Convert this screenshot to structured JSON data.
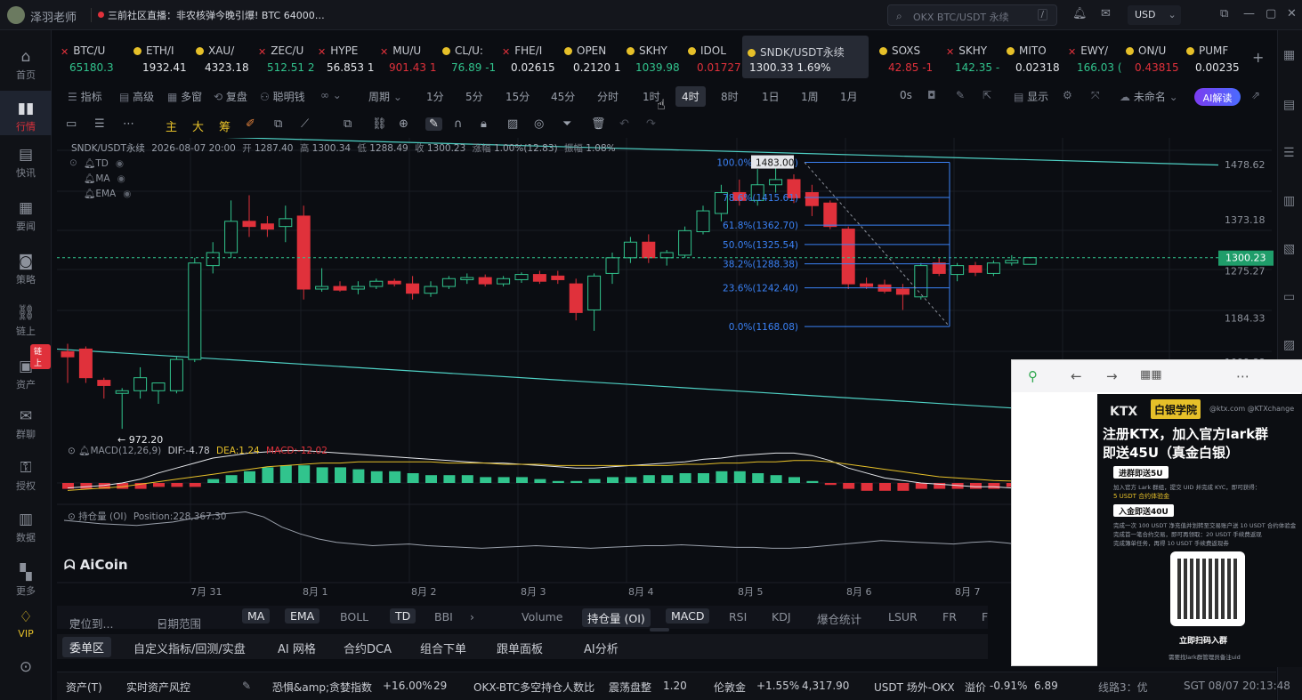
{
  "titlebar": {
    "user_name": "泽羽老师",
    "news": "三前社区直播：非农核弹今晚引爆! BTC 64000…",
    "search_placeholder": "OKX BTC/USDT 永续",
    "search_shortcut": "/",
    "currency": "USD"
  },
  "leftnav": {
    "items": [
      {
        "label": "首页",
        "icon": "home-icon"
      },
      {
        "label": "行情",
        "icon": "chart-icon"
      },
      {
        "label": "快讯",
        "icon": "news-icon"
      },
      {
        "label": "要闻",
        "icon": "document-icon"
      },
      {
        "label": "策略",
        "icon": "robot-icon"
      },
      {
        "label": "链上",
        "icon": "chain-icon"
      },
      {
        "label": "资产",
        "icon": "wallet-icon"
      },
      {
        "label": "群聊",
        "icon": "chat-icon"
      },
      {
        "label": "授权",
        "icon": "key-icon"
      },
      {
        "label": "数据",
        "icon": "data-icon"
      },
      {
        "label": "更多",
        "icon": "grid-icon"
      },
      {
        "label": "VIP",
        "icon": "vip-icon"
      }
    ],
    "badge": "链上"
  },
  "tickers": [
    {
      "symbol": "BTC/U",
      "price": "65180.3",
      "change": "",
      "dir": "up",
      "mark": "x"
    },
    {
      "symbol": "ETH/I",
      "price": "1932.41",
      "change": "",
      "dir": "wh",
      "mark": "yellow"
    },
    {
      "symbol": "XAU/",
      "price": "4323.18",
      "change": "",
      "dir": "wh",
      "mark": "yellow"
    },
    {
      "symbol": "ZEC/U",
      "price": "512.51",
      "change": "2",
      "dir": "up",
      "mark": "x"
    },
    {
      "symbol": "HYPE",
      "price": "56.853",
      "change": "1",
      "dir": "wh",
      "mark": "x"
    },
    {
      "symbol": "MU/U",
      "price": "901.43",
      "change": "1",
      "dir": "dn",
      "mark": "x"
    },
    {
      "symbol": "CL/U:",
      "price": "76.89",
      "change": "-1",
      "dir": "up",
      "mark": "yellow"
    },
    {
      "symbol": "FHE/I",
      "price": "0.02615",
      "change": "",
      "dir": "wh",
      "mark": "x"
    },
    {
      "symbol": "OPEN",
      "price": "0.2120",
      "change": "1",
      "dir": "wh",
      "mark": "yellow"
    },
    {
      "symbol": "SKHY",
      "price": "1039.98",
      "change": "",
      "dir": "up",
      "mark": "yellow"
    },
    {
      "symbol": "IDOL",
      "price": "0.01727",
      "change": "",
      "dir": "dn",
      "mark": "yellow"
    },
    {
      "symbol": "SNDK/USDT永续",
      "price": "1300.33",
      "change": "1.69%",
      "dir": "wh",
      "mark": "yellow",
      "active": true
    },
    {
      "symbol": "SOXS",
      "price": "42.85",
      "change": "-1",
      "dir": "dn",
      "mark": "yellow"
    },
    {
      "symbol": "SKHY",
      "price": "142.35",
      "change": "-",
      "dir": "up",
      "mark": "x"
    },
    {
      "symbol": "MITO",
      "price": "0.02318",
      "change": "",
      "dir": "wh",
      "mark": "yellow"
    },
    {
      "symbol": "EWY/",
      "price": "166.03",
      "change": "(",
      "dir": "up",
      "mark": "x"
    },
    {
      "symbol": "ON/U",
      "price": "0.43815",
      "change": "",
      "dir": "dn",
      "mark": "yellow"
    },
    {
      "symbol": "PUMF",
      "price": "0.00235",
      "change": "",
      "dir": "wh",
      "mark": "yellow"
    }
  ],
  "toolbar1": {
    "items": [
      "指标",
      "高级",
      "多窗",
      "复盘",
      "聪明钱",
      "周期",
      "1分",
      "5分",
      "15分",
      "45分",
      "分时",
      "1时",
      "4时",
      "8时",
      "1日",
      "1周",
      "1月",
      "0s",
      "显示",
      "未命名"
    ],
    "selected": "4时",
    "ai_button": "AI解读"
  },
  "toolbar2": {
    "items": [
      "主",
      "大",
      "筹"
    ]
  },
  "chart_header": {
    "pair": "SNDK/USDT永续",
    "datetime": "2026-08-07 20:00",
    "open_label": "开",
    "open": "1287.40",
    "high_label": "高",
    "high": "1300.34",
    "low_label": "低",
    "low": "1288.49",
    "close_label": "收",
    "close": "1300.23",
    "chg_label": "涨幅",
    "chg": "1.00%(12.83)",
    "amp_label": "振幅",
    "amp": "1.08%",
    "indicators": [
      "TD",
      "MA",
      "EMA"
    ]
  },
  "chart_data": {
    "type": "candlestick",
    "price_axis": [
      "1478.62",
      "1373.18",
      "1275.27",
      "1184.33",
      "1099.88"
    ],
    "current_price": "1300.23",
    "low_marker": "← 972.20",
    "x_labels": [
      "7月 31",
      "8月 1",
      "8月 2",
      "8月 3",
      "8月 4",
      "8月 5",
      "8月 6",
      "8月 7"
    ],
    "ylim": [
      950,
      1530
    ],
    "candles": [
      {
        "o": 1120,
        "h": 1135,
        "l": 1060,
        "c": 1110
      },
      {
        "o": 1125,
        "h": 1130,
        "l": 1060,
        "c": 1070
      },
      {
        "o": 1065,
        "h": 1070,
        "l": 1030,
        "c": 1055
      },
      {
        "o": 1040,
        "h": 1050,
        "l": 972,
        "c": 1045
      },
      {
        "o": 1045,
        "h": 1090,
        "l": 1030,
        "c": 1070
      },
      {
        "o": 1045,
        "h": 1060,
        "l": 1020,
        "c": 1060
      },
      {
        "o": 1045,
        "h": 1110,
        "l": 1040,
        "c": 1105
      },
      {
        "o": 1105,
        "h": 1300,
        "l": 1100,
        "c": 1290
      },
      {
        "o": 1285,
        "h": 1330,
        "l": 1270,
        "c": 1310
      },
      {
        "o": 1310,
        "h": 1410,
        "l": 1300,
        "c": 1370
      },
      {
        "o": 1370,
        "h": 1420,
        "l": 1340,
        "c": 1360
      },
      {
        "o": 1365,
        "h": 1380,
        "l": 1340,
        "c": 1355
      },
      {
        "o": 1360,
        "h": 1400,
        "l": 1330,
        "c": 1375
      },
      {
        "o": 1380,
        "h": 1400,
        "l": 1220,
        "c": 1240
      },
      {
        "o": 1240,
        "h": 1280,
        "l": 1235,
        "c": 1245
      },
      {
        "o": 1245,
        "h": 1255,
        "l": 1235,
        "c": 1238
      },
      {
        "o": 1240,
        "h": 1255,
        "l": 1230,
        "c": 1245
      },
      {
        "o": 1245,
        "h": 1260,
        "l": 1240,
        "c": 1255
      },
      {
        "o": 1255,
        "h": 1260,
        "l": 1245,
        "c": 1250
      },
      {
        "o": 1250,
        "h": 1265,
        "l": 1220,
        "c": 1232
      },
      {
        "o": 1232,
        "h": 1255,
        "l": 1225,
        "c": 1245
      },
      {
        "o": 1245,
        "h": 1265,
        "l": 1240,
        "c": 1260
      },
      {
        "o": 1258,
        "h": 1270,
        "l": 1250,
        "c": 1262
      },
      {
        "o": 1262,
        "h": 1268,
        "l": 1245,
        "c": 1250
      },
      {
        "o": 1250,
        "h": 1265,
        "l": 1245,
        "c": 1260
      },
      {
        "o": 1258,
        "h": 1272,
        "l": 1252,
        "c": 1268
      },
      {
        "o": 1268,
        "h": 1275,
        "l": 1250,
        "c": 1255
      },
      {
        "o": 1265,
        "h": 1275,
        "l": 1250,
        "c": 1258
      },
      {
        "o": 1250,
        "h": 1260,
        "l": 1180,
        "c": 1195
      },
      {
        "o": 1200,
        "h": 1270,
        "l": 1160,
        "c": 1265
      },
      {
        "o": 1270,
        "h": 1310,
        "l": 1250,
        "c": 1300
      },
      {
        "o": 1300,
        "h": 1340,
        "l": 1290,
        "c": 1330
      },
      {
        "o": 1330,
        "h": 1345,
        "l": 1290,
        "c": 1300
      },
      {
        "o": 1300,
        "h": 1315,
        "l": 1285,
        "c": 1310
      },
      {
        "o": 1305,
        "h": 1360,
        "l": 1300,
        "c": 1352
      },
      {
        "o": 1350,
        "h": 1400,
        "l": 1345,
        "c": 1390
      },
      {
        "o": 1385,
        "h": 1440,
        "l": 1370,
        "c": 1425
      },
      {
        "o": 1425,
        "h": 1450,
        "l": 1400,
        "c": 1410
      },
      {
        "o": 1410,
        "h": 1470,
        "l": 1400,
        "c": 1440
      },
      {
        "o": 1440,
        "h": 1483,
        "l": 1425,
        "c": 1450
      },
      {
        "o": 1450,
        "h": 1460,
        "l": 1405,
        "c": 1415
      },
      {
        "o": 1425,
        "h": 1440,
        "l": 1380,
        "c": 1400
      },
      {
        "o": 1405,
        "h": 1410,
        "l": 1355,
        "c": 1360
      },
      {
        "o": 1355,
        "h": 1360,
        "l": 1240,
        "c": 1250
      },
      {
        "o": 1250,
        "h": 1262,
        "l": 1240,
        "c": 1245
      },
      {
        "o": 1248,
        "h": 1258,
        "l": 1232,
        "c": 1236
      },
      {
        "o": 1240,
        "h": 1250,
        "l": 1200,
        "c": 1230
      },
      {
        "o": 1225,
        "h": 1290,
        "l": 1220,
        "c": 1285
      },
      {
        "o": 1290,
        "h": 1300,
        "l": 1265,
        "c": 1270
      },
      {
        "o": 1268,
        "h": 1290,
        "l": 1255,
        "c": 1285
      },
      {
        "o": 1285,
        "h": 1292,
        "l": 1265,
        "c": 1272
      },
      {
        "o": 1270,
        "h": 1295,
        "l": 1265,
        "c": 1290
      },
      {
        "o": 1290,
        "h": 1305,
        "l": 1285,
        "c": 1295
      },
      {
        "o": 1287.4,
        "h": 1300.34,
        "l": 1288.49,
        "c": 1300.23
      }
    ],
    "fib": [
      {
        "label": "100.0%(1483.00)",
        "price": 1483.0
      },
      {
        "label": "78.6%(1415.61)",
        "price": 1415.61
      },
      {
        "label": "61.8%(1362.70)",
        "price": 1362.7
      },
      {
        "label": "50.0%(1325.54)",
        "price": 1325.54
      },
      {
        "label": "38.2%(1288.38)",
        "price": 1288.38
      },
      {
        "label": "23.6%(1242.40)",
        "price": 1242.4
      },
      {
        "label": "0.0%(1168.08)",
        "price": 1168.08
      }
    ],
    "fib_high_label": "1483.00",
    "channel": {
      "upper": [
        1540,
        1478
      ],
      "lower": [
        1125,
        1080
      ]
    }
  },
  "macd": {
    "label": "MACD(12,26,9)",
    "dif": "DIF:-4.78",
    "dea": "DEA:1.24",
    "macd": "MACD:-12.02",
    "bars": [
      -3,
      -3,
      -3,
      -3,
      -3,
      -2,
      -2,
      -2,
      2,
      4,
      6,
      8,
      9,
      9,
      8,
      8,
      7,
      6,
      6,
      5,
      4,
      4,
      4,
      3,
      3,
      3,
      2,
      1,
      1,
      2,
      3,
      3,
      4,
      4,
      5,
      5,
      6,
      6,
      5,
      4,
      3,
      1,
      -1,
      -3,
      -4,
      -4,
      -4,
      -3,
      -3,
      -3,
      -3,
      -3,
      -2,
      -2
    ],
    "dif_line": [
      -4,
      -3,
      -2,
      0,
      3,
      8,
      12,
      16,
      20,
      22,
      24,
      25,
      26,
      26,
      25,
      24,
      23,
      22,
      21,
      20,
      19,
      18,
      17,
      16,
      16,
      15,
      14,
      13,
      12,
      12,
      13,
      14,
      15,
      16,
      17,
      19,
      20,
      22,
      23,
      24,
      24,
      22,
      18,
      12,
      8,
      4,
      2,
      0,
      -1,
      -2,
      -3,
      -3,
      -4,
      -4.78
    ],
    "dea_line": [
      -6,
      -5,
      -4,
      -3,
      -1,
      1,
      3,
      5,
      7,
      9,
      11,
      13,
      14,
      15,
      16,
      16,
      17,
      17,
      17,
      17,
      17,
      16,
      16,
      16,
      15,
      15,
      15,
      14,
      14,
      14,
      14,
      14,
      14,
      14,
      15,
      15,
      16,
      16,
      17,
      17,
      18,
      18,
      17,
      15,
      13,
      11,
      9,
      7,
      5,
      4,
      3,
      2,
      1.5,
      1.24
    ]
  },
  "oi": {
    "label": "持仓量 (OI)",
    "position": "Position:228,367.30",
    "values": [
      60,
      58,
      56,
      55,
      54,
      56,
      58,
      62,
      66,
      68,
      70,
      64,
      52,
      44,
      38,
      34,
      32,
      30,
      31,
      32,
      30,
      29,
      28,
      27,
      28,
      29,
      30,
      29,
      28,
      27,
      28,
      29,
      30,
      30,
      31,
      30,
      29,
      28,
      28,
      27,
      27,
      28,
      30,
      32,
      34,
      36,
      35,
      34,
      33,
      32,
      34,
      35,
      33,
      30
    ]
  },
  "logo": "AiCoin",
  "bottombar1": {
    "locate": "定位到...",
    "date_range": "日期范围",
    "items": [
      "MA",
      "EMA",
      "BOLL",
      "TD",
      "BBI",
      "Volume",
      "持仓量 (OI)",
      "MACD",
      "RSI",
      "KDJ",
      "爆仓统计",
      "LSUR",
      "FR",
      "F"
    ]
  },
  "bottombar2": {
    "items": [
      "委单区",
      "自定义指标/回测/实盘",
      "AI 网格",
      "合约DCA",
      "组合下单",
      "跟单面板",
      "AI分析"
    ]
  },
  "statusbar": {
    "assets": "资产(T)",
    "risk": "实时资产风控",
    "fear_label": "恐惧&amp;贪婪指数",
    "fear_chg": "+16.00%",
    "fear_val": "29",
    "ratio_label": "OKX-BTC多空持仓人数比",
    "ratio_state": "震荡盘整",
    "ratio_val": "1.20",
    "gold_label": "伦敦金",
    "gold_chg": "+1.55%",
    "gold_val": "4,317.90",
    "otc_label": "USDT 场外-OKX",
    "otc_state": "溢价",
    "otc_chg": "-0.91%",
    "otc_val": "6.89",
    "tail": "线路3：优",
    "clock": "SGT 08/07 20:13:48"
  },
  "popup_ad": {
    "brand": "KTX",
    "brand_box": "白银学院",
    "site": "@ktx.com  @KTXchange",
    "headline1": "注册KTX，加入官方lark群",
    "headline2": "即送45U（真金白银）",
    "chip1": "进群即送5U",
    "text1": "加入官方 Lark 群组，提交 UID 并完成 KYC，即可获得：",
    "text2": "5 USDT 合约体验金",
    "chip2": "入金即送40U",
    "text3": "完成一次 100 USDT 净充值并划转至交易账户送 10 USDT 合约体验金",
    "text4": "完成首一笔合约交易，即可再领取：20 USDT 手续费返现",
    "text5": "完成簿单任务，再得 10 USDT 手续费返现券",
    "scan": "立即扫码入群",
    "note": "需要找lark群管理员备注uid"
  }
}
